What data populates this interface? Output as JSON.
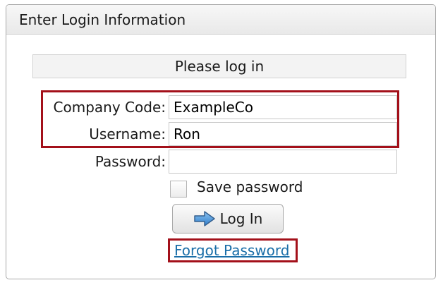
{
  "window": {
    "title": "Enter Login Information"
  },
  "form": {
    "subtitle": "Please log in",
    "company_code": {
      "label": "Company Code:",
      "value": "ExampleCo"
    },
    "username": {
      "label": "Username:",
      "value": "Ron"
    },
    "password": {
      "label": "Password:",
      "value": ""
    },
    "save_password": {
      "label": "Save password",
      "checked": false
    },
    "login_button": {
      "label": "Log In",
      "icon": "arrow-right-icon"
    },
    "forgot_password_link": "Forgot Password"
  },
  "colors": {
    "highlight": "#a3101a",
    "link": "#1a6ea8",
    "arrow_fill": "#4a90d9"
  }
}
